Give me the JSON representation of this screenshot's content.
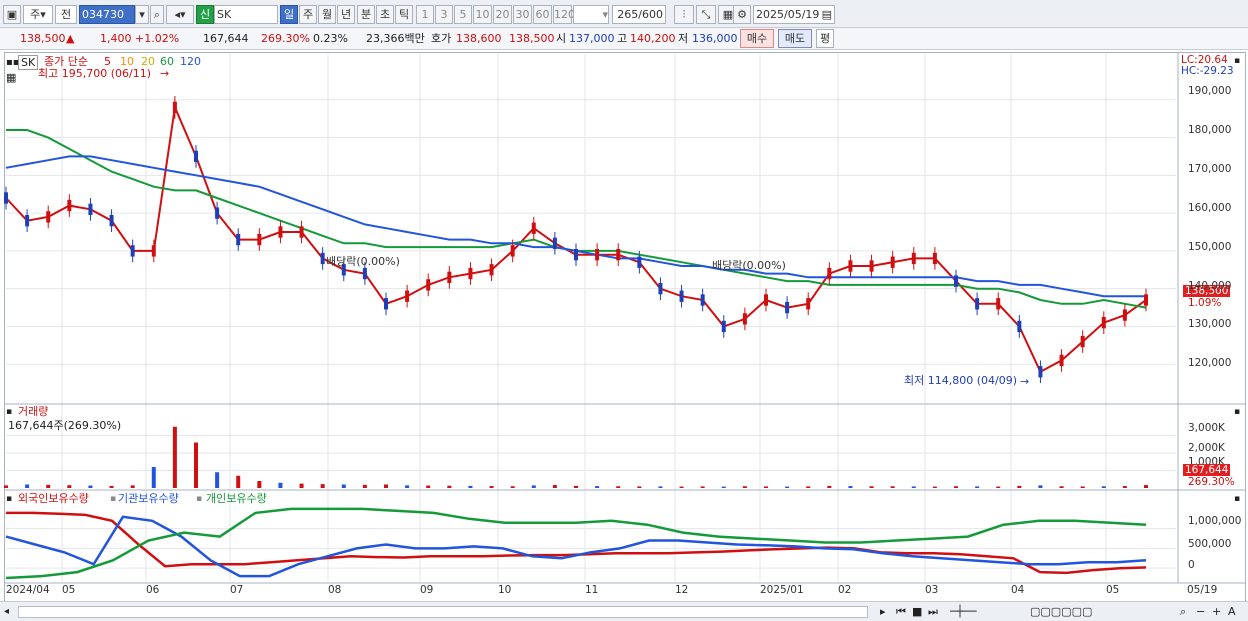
{
  "toolbar": {
    "market": "주",
    "period_btn": "전",
    "code": "034730",
    "name": "SK",
    "tag": "신",
    "tf": [
      "일",
      "주",
      "월",
      "년",
      "분",
      "초",
      "틱"
    ],
    "nums": [
      "1",
      "3",
      "5",
      "10",
      "20",
      "30",
      "60",
      "120"
    ],
    "count": "265",
    "count_total": "/600",
    "date": "2025/05/19"
  },
  "quote": {
    "price": "138,500",
    "arrow": "▲",
    "change": "1,400",
    "pct": "+1.02%",
    "volume": "167,644",
    "vol_ratio": "269.30%",
    "turnover": "0.23%",
    "amount": "23,366백만",
    "bid_label": "호가",
    "bid": "138,600",
    "ask": "138,500",
    "open_label": "시",
    "open": "137,000",
    "high_label": "고",
    "high": "140,200",
    "low_label": "저",
    "low": "136,000",
    "buy_btn": "매수",
    "sell_btn": "매도",
    "avg_btn": "평"
  },
  "price_panel": {
    "symbol": "SK",
    "legend_prefix": "종가 단순",
    "ma": [
      {
        "label": "5",
        "color": "#d01010"
      },
      {
        "label": "10",
        "color": "#ff8c00"
      },
      {
        "label": "20",
        "color": "#f0e000"
      },
      {
        "label": "60",
        "color": "#159a3a"
      },
      {
        "label": "120",
        "color": "#2255dd"
      }
    ],
    "high_note": "최고 195,700 (06/11)",
    "low_note": "최저 114,800 (04/09)",
    "div_note1": "배당락(0.00%)",
    "div_note2": "배당락(0.00%)",
    "lc": "LC:20.64",
    "hc": "HC:-29.23",
    "cur_price": "138,500",
    "cur_pct": "1.09%"
  },
  "volume_panel": {
    "title": "거래량",
    "value": "167,644주(269.30%)",
    "cur": "167,644",
    "pct": "269.30%"
  },
  "holdings_panel": {
    "legend": [
      {
        "label": "외국인보유수량",
        "color": "#d01010"
      },
      {
        "label": "기관보유수량",
        "color": "#2255dd"
      },
      {
        "label": "개인보유수량",
        "color": "#159a3a"
      }
    ]
  },
  "chart_data": [
    {
      "type": "line",
      "title": "SK",
      "series": [
        {
          "name": "5",
          "values": [
            164000,
            158000,
            159000,
            162000,
            161000,
            158000,
            150000,
            150000,
            188000,
            175000,
            160000,
            153000,
            153000,
            155000,
            155000,
            148000,
            145000,
            144000,
            136000,
            138000,
            141000,
            143000,
            144000,
            145000,
            150000,
            156000,
            152000,
            149000,
            149000,
            149000,
            147000,
            140000,
            138000,
            137000,
            130000,
            132000,
            137000,
            135000,
            136000,
            144000,
            146000,
            146000,
            147000,
            148000,
            148000,
            142000,
            136000,
            136000,
            130000,
            118000,
            121000,
            126000,
            131000,
            133000,
            137000
          ]
        },
        {
          "name": "60",
          "values": [
            182000,
            182000,
            180000,
            177000,
            174000,
            171000,
            169000,
            167000,
            166000,
            166000,
            164000,
            162000,
            160000,
            158000,
            156000,
            154000,
            152000,
            152000,
            151000,
            151000,
            151000,
            151000,
            151000,
            151000,
            152000,
            153000,
            151000,
            150000,
            150000,
            150000,
            149000,
            148000,
            147000,
            146000,
            145000,
            144000,
            143000,
            142000,
            142000,
            141000,
            141000,
            141000,
            141000,
            141000,
            141000,
            141000,
            140000,
            140000,
            139000,
            137000,
            136000,
            136000,
            137000,
            136000,
            135000
          ]
        },
        {
          "name": "120",
          "values": [
            172000,
            173000,
            174000,
            175000,
            175000,
            174000,
            173000,
            172000,
            171000,
            170000,
            169000,
            168000,
            167000,
            165000,
            163000,
            161000,
            159000,
            157000,
            156000,
            155000,
            154000,
            153000,
            153000,
            152000,
            152000,
            151000,
            151000,
            150000,
            149000,
            148000,
            148000,
            147000,
            146000,
            146000,
            145000,
            145000,
            144000,
            144000,
            143000,
            143000,
            143000,
            143000,
            143000,
            143000,
            143000,
            143000,
            142000,
            142000,
            141000,
            141000,
            140000,
            139000,
            138000,
            138000,
            138000
          ]
        }
      ],
      "x": [
        "2024/04",
        "05",
        "06",
        "07",
        "08",
        "09",
        "10",
        "11",
        "12",
        "2025/01",
        "02",
        "03",
        "04",
        "05",
        "05/19"
      ],
      "ylim": [
        110000,
        200000
      ],
      "y_ticks": [
        "190,000",
        "180,000",
        "170,000",
        "160,000",
        "150,000",
        "140,000",
        "130,000",
        "120,000"
      ],
      "grid": true,
      "legend": "top-left"
    },
    {
      "type": "bar",
      "title": "거래량",
      "y_ticks": [
        "3,000K",
        "2,000K",
        "1,000K"
      ],
      "ylim": [
        0,
        4000000
      ],
      "values": [
        150000,
        200000,
        180000,
        160000,
        140000,
        120000,
        150000,
        1200000,
        3500000,
        2600000,
        900000,
        700000,
        400000,
        300000,
        250000,
        220000,
        200000,
        180000,
        200000,
        150000,
        140000,
        130000,
        120000,
        110000,
        100000,
        150000,
        170000,
        120000,
        110000,
        100000,
        90000,
        90000,
        80000,
        90000,
        80000,
        100000,
        90000,
        80000,
        90000,
        120000,
        110000,
        100000,
        100000,
        90000,
        80000,
        100000,
        90000,
        80000,
        120000,
        150000,
        100000,
        90000,
        100000,
        110000,
        167644
      ]
    },
    {
      "type": "line",
      "title": "보유수량",
      "y_ticks": [
        "1,000,000",
        "500,000",
        "0"
      ],
      "series": [
        {
          "name": "외국인보유수량",
          "values": [
            1400000,
            1400000,
            1380000,
            1350000,
            1200000,
            600000,
            50000,
            100000,
            100000,
            100000,
            150000,
            200000,
            250000,
            300000,
            280000,
            270000,
            300000,
            300000,
            300000,
            320000,
            330000,
            330000,
            350000,
            380000,
            380000,
            380000,
            400000,
            420000,
            450000,
            480000,
            500000,
            520000,
            500000,
            400000,
            380000,
            380000,
            350000,
            300000,
            250000,
            -100000,
            -120000,
            -50000,
            0,
            20000
          ]
        },
        {
          "name": "기관보유수량",
          "values": [
            800000,
            600000,
            400000,
            100000,
            1300000,
            1200000,
            800000,
            200000,
            -200000,
            -200000,
            100000,
            300000,
            500000,
            600000,
            500000,
            500000,
            550000,
            500000,
            300000,
            250000,
            400000,
            500000,
            700000,
            700000,
            650000,
            600000,
            580000,
            550000,
            500000,
            480000,
            380000,
            300000,
            250000,
            200000,
            150000,
            100000,
            100000,
            150000,
            150000,
            200000
          ]
        },
        {
          "name": "개인보유수량",
          "values": [
            -250000,
            -200000,
            -100000,
            200000,
            700000,
            900000,
            800000,
            1400000,
            1500000,
            1500000,
            1500000,
            1450000,
            1400000,
            1250000,
            1150000,
            1150000,
            1150000,
            1200000,
            1100000,
            900000,
            800000,
            750000,
            700000,
            650000,
            650000,
            700000,
            750000,
            800000,
            1100000,
            1200000,
            1200000,
            1150000,
            1100000
          ]
        }
      ],
      "x": [
        "2024/04",
        "05",
        "06",
        "07",
        "08",
        "09",
        "10",
        "11",
        "12",
        "2025/01",
        "02",
        "03",
        "04",
        "05",
        "05/19"
      ]
    }
  ],
  "x_labels": [
    "2024/04",
    "05",
    "06",
    "07",
    "08",
    "09",
    "10",
    "11",
    "12",
    "2025/01",
    "02",
    "03",
    "04",
    "05",
    "05/19"
  ]
}
